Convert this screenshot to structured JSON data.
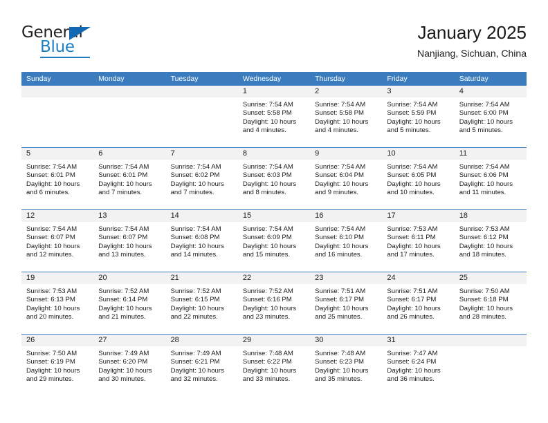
{
  "brand": {
    "name_part1": "General",
    "name_part2": "Blue"
  },
  "header": {
    "title": "January 2025",
    "subtitle": "Nanjiang, Sichuan, China"
  },
  "weekdays": [
    "Sunday",
    "Monday",
    "Tuesday",
    "Wednesday",
    "Thursday",
    "Friday",
    "Saturday"
  ],
  "colors": {
    "header_blue": "#3a7cbe",
    "day_band_gray": "#f2f2f2",
    "brand_blue": "#1f7fc4",
    "logo_triangle": "#1268b3"
  },
  "labels": {
    "sunrise_prefix": "Sunrise: ",
    "sunset_prefix": "Sunset: ",
    "daylight_prefix": "Daylight: "
  },
  "weeks": [
    [
      {
        "day": "",
        "sunrise": "",
        "sunset": "",
        "daylight_line1": "",
        "daylight_line2": ""
      },
      {
        "day": "",
        "sunrise": "",
        "sunset": "",
        "daylight_line1": "",
        "daylight_line2": ""
      },
      {
        "day": "",
        "sunrise": "",
        "sunset": "",
        "daylight_line1": "",
        "daylight_line2": ""
      },
      {
        "day": "1",
        "sunrise": "Sunrise: 7:54 AM",
        "sunset": "Sunset: 5:58 PM",
        "daylight_line1": "Daylight: 10 hours",
        "daylight_line2": "and 4 minutes."
      },
      {
        "day": "2",
        "sunrise": "Sunrise: 7:54 AM",
        "sunset": "Sunset: 5:58 PM",
        "daylight_line1": "Daylight: 10 hours",
        "daylight_line2": "and 4 minutes."
      },
      {
        "day": "3",
        "sunrise": "Sunrise: 7:54 AM",
        "sunset": "Sunset: 5:59 PM",
        "daylight_line1": "Daylight: 10 hours",
        "daylight_line2": "and 5 minutes."
      },
      {
        "day": "4",
        "sunrise": "Sunrise: 7:54 AM",
        "sunset": "Sunset: 6:00 PM",
        "daylight_line1": "Daylight: 10 hours",
        "daylight_line2": "and 5 minutes."
      }
    ],
    [
      {
        "day": "5",
        "sunrise": "Sunrise: 7:54 AM",
        "sunset": "Sunset: 6:01 PM",
        "daylight_line1": "Daylight: 10 hours",
        "daylight_line2": "and 6 minutes."
      },
      {
        "day": "6",
        "sunrise": "Sunrise: 7:54 AM",
        "sunset": "Sunset: 6:01 PM",
        "daylight_line1": "Daylight: 10 hours",
        "daylight_line2": "and 7 minutes."
      },
      {
        "day": "7",
        "sunrise": "Sunrise: 7:54 AM",
        "sunset": "Sunset: 6:02 PM",
        "daylight_line1": "Daylight: 10 hours",
        "daylight_line2": "and 7 minutes."
      },
      {
        "day": "8",
        "sunrise": "Sunrise: 7:54 AM",
        "sunset": "Sunset: 6:03 PM",
        "daylight_line1": "Daylight: 10 hours",
        "daylight_line2": "and 8 minutes."
      },
      {
        "day": "9",
        "sunrise": "Sunrise: 7:54 AM",
        "sunset": "Sunset: 6:04 PM",
        "daylight_line1": "Daylight: 10 hours",
        "daylight_line2": "and 9 minutes."
      },
      {
        "day": "10",
        "sunrise": "Sunrise: 7:54 AM",
        "sunset": "Sunset: 6:05 PM",
        "daylight_line1": "Daylight: 10 hours",
        "daylight_line2": "and 10 minutes."
      },
      {
        "day": "11",
        "sunrise": "Sunrise: 7:54 AM",
        "sunset": "Sunset: 6:06 PM",
        "daylight_line1": "Daylight: 10 hours",
        "daylight_line2": "and 11 minutes."
      }
    ],
    [
      {
        "day": "12",
        "sunrise": "Sunrise: 7:54 AM",
        "sunset": "Sunset: 6:07 PM",
        "daylight_line1": "Daylight: 10 hours",
        "daylight_line2": "and 12 minutes."
      },
      {
        "day": "13",
        "sunrise": "Sunrise: 7:54 AM",
        "sunset": "Sunset: 6:07 PM",
        "daylight_line1": "Daylight: 10 hours",
        "daylight_line2": "and 13 minutes."
      },
      {
        "day": "14",
        "sunrise": "Sunrise: 7:54 AM",
        "sunset": "Sunset: 6:08 PM",
        "daylight_line1": "Daylight: 10 hours",
        "daylight_line2": "and 14 minutes."
      },
      {
        "day": "15",
        "sunrise": "Sunrise: 7:54 AM",
        "sunset": "Sunset: 6:09 PM",
        "daylight_line1": "Daylight: 10 hours",
        "daylight_line2": "and 15 minutes."
      },
      {
        "day": "16",
        "sunrise": "Sunrise: 7:54 AM",
        "sunset": "Sunset: 6:10 PM",
        "daylight_line1": "Daylight: 10 hours",
        "daylight_line2": "and 16 minutes."
      },
      {
        "day": "17",
        "sunrise": "Sunrise: 7:53 AM",
        "sunset": "Sunset: 6:11 PM",
        "daylight_line1": "Daylight: 10 hours",
        "daylight_line2": "and 17 minutes."
      },
      {
        "day": "18",
        "sunrise": "Sunrise: 7:53 AM",
        "sunset": "Sunset: 6:12 PM",
        "daylight_line1": "Daylight: 10 hours",
        "daylight_line2": "and 18 minutes."
      }
    ],
    [
      {
        "day": "19",
        "sunrise": "Sunrise: 7:53 AM",
        "sunset": "Sunset: 6:13 PM",
        "daylight_line1": "Daylight: 10 hours",
        "daylight_line2": "and 20 minutes."
      },
      {
        "day": "20",
        "sunrise": "Sunrise: 7:52 AM",
        "sunset": "Sunset: 6:14 PM",
        "daylight_line1": "Daylight: 10 hours",
        "daylight_line2": "and 21 minutes."
      },
      {
        "day": "21",
        "sunrise": "Sunrise: 7:52 AM",
        "sunset": "Sunset: 6:15 PM",
        "daylight_line1": "Daylight: 10 hours",
        "daylight_line2": "and 22 minutes."
      },
      {
        "day": "22",
        "sunrise": "Sunrise: 7:52 AM",
        "sunset": "Sunset: 6:16 PM",
        "daylight_line1": "Daylight: 10 hours",
        "daylight_line2": "and 23 minutes."
      },
      {
        "day": "23",
        "sunrise": "Sunrise: 7:51 AM",
        "sunset": "Sunset: 6:17 PM",
        "daylight_line1": "Daylight: 10 hours",
        "daylight_line2": "and 25 minutes."
      },
      {
        "day": "24",
        "sunrise": "Sunrise: 7:51 AM",
        "sunset": "Sunset: 6:17 PM",
        "daylight_line1": "Daylight: 10 hours",
        "daylight_line2": "and 26 minutes."
      },
      {
        "day": "25",
        "sunrise": "Sunrise: 7:50 AM",
        "sunset": "Sunset: 6:18 PM",
        "daylight_line1": "Daylight: 10 hours",
        "daylight_line2": "and 28 minutes."
      }
    ],
    [
      {
        "day": "26",
        "sunrise": "Sunrise: 7:50 AM",
        "sunset": "Sunset: 6:19 PM",
        "daylight_line1": "Daylight: 10 hours",
        "daylight_line2": "and 29 minutes."
      },
      {
        "day": "27",
        "sunrise": "Sunrise: 7:49 AM",
        "sunset": "Sunset: 6:20 PM",
        "daylight_line1": "Daylight: 10 hours",
        "daylight_line2": "and 30 minutes."
      },
      {
        "day": "28",
        "sunrise": "Sunrise: 7:49 AM",
        "sunset": "Sunset: 6:21 PM",
        "daylight_line1": "Daylight: 10 hours",
        "daylight_line2": "and 32 minutes."
      },
      {
        "day": "29",
        "sunrise": "Sunrise: 7:48 AM",
        "sunset": "Sunset: 6:22 PM",
        "daylight_line1": "Daylight: 10 hours",
        "daylight_line2": "and 33 minutes."
      },
      {
        "day": "30",
        "sunrise": "Sunrise: 7:48 AM",
        "sunset": "Sunset: 6:23 PM",
        "daylight_line1": "Daylight: 10 hours",
        "daylight_line2": "and 35 minutes."
      },
      {
        "day": "31",
        "sunrise": "Sunrise: 7:47 AM",
        "sunset": "Sunset: 6:24 PM",
        "daylight_line1": "Daylight: 10 hours",
        "daylight_line2": "and 36 minutes."
      },
      {
        "day": "",
        "sunrise": "",
        "sunset": "",
        "daylight_line1": "",
        "daylight_line2": ""
      }
    ]
  ]
}
